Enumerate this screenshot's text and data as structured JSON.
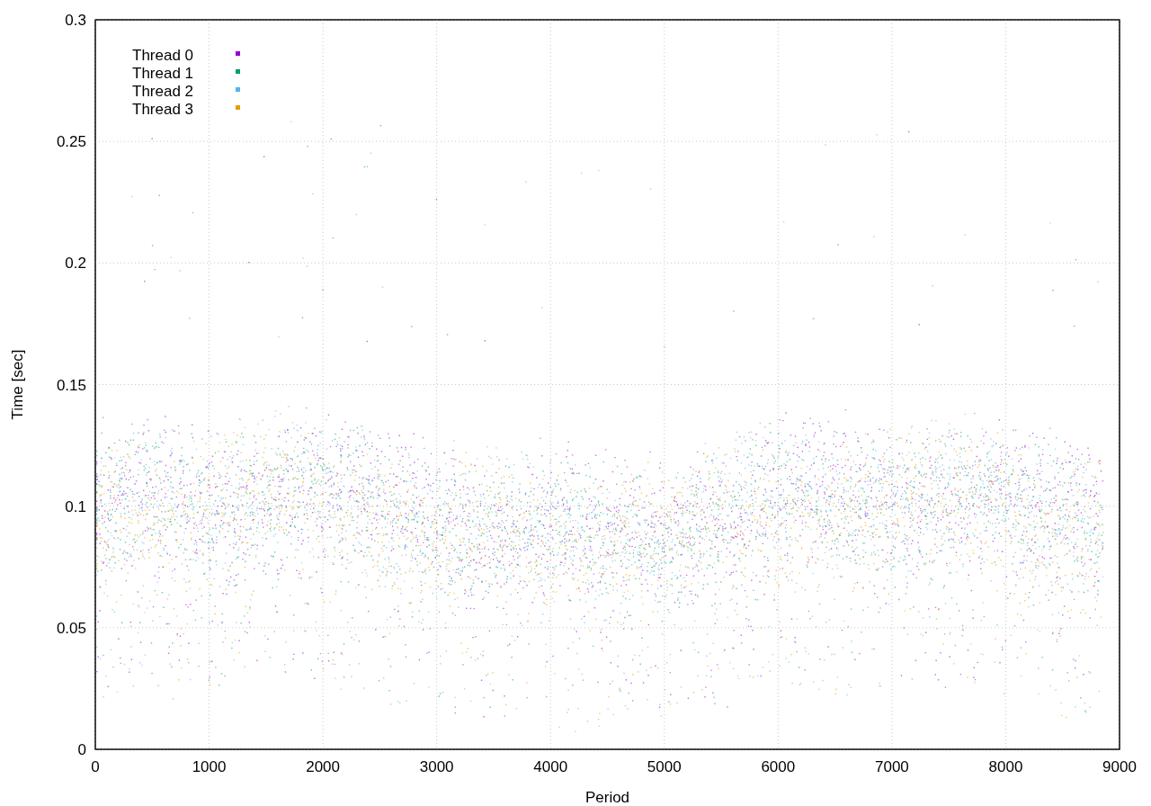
{
  "plot": {
    "x_axis": {
      "title": "Period",
      "ticks": [
        "0",
        "1000",
        "2000",
        "3000",
        "4000",
        "5000",
        "6000",
        "7000",
        "8000",
        "9000"
      ]
    },
    "y_axis": {
      "title": "Time [sec]",
      "ticks": [
        "0.3",
        "0.25",
        "0.2",
        "0.15",
        "0.1",
        "0.05",
        "0"
      ]
    },
    "grid": true,
    "legend": [
      {
        "name": "Thread 0",
        "color": "#9400d3"
      },
      {
        "name": "Thread 1",
        "color": "#009e73"
      },
      {
        "name": "Thread 2",
        "color": "#56b4e9"
      },
      {
        "name": "Thread 3",
        "color": "#e69f00"
      }
    ]
  }
}
